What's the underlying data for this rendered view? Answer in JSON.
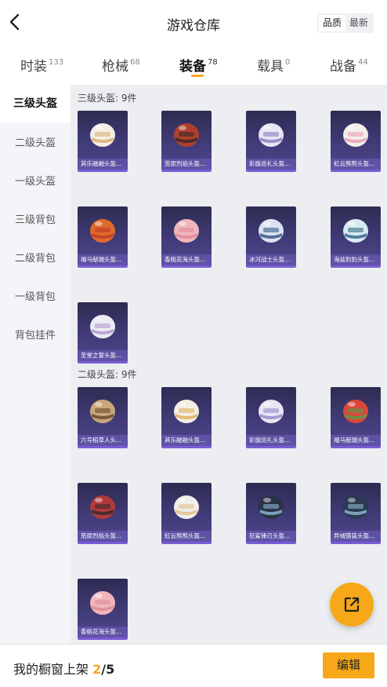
{
  "header": {
    "title": "游戏仓库",
    "sort_options": [
      "品质",
      "最新"
    ],
    "sort_selected": "品质"
  },
  "tabs": [
    {
      "label": "时装",
      "count": "133"
    },
    {
      "label": "枪械",
      "count": "68"
    },
    {
      "label": "装备",
      "count": "78",
      "active": true
    },
    {
      "label": "载具",
      "count": "0"
    },
    {
      "label": "战备",
      "count": "44"
    }
  ],
  "sidebar": {
    "items": [
      {
        "label": "三级头盔",
        "active": true
      },
      {
        "label": "二级头盔"
      },
      {
        "label": "一级头盔"
      },
      {
        "label": "三级背包"
      },
      {
        "label": "二级背包"
      },
      {
        "label": "一级背包"
      },
      {
        "label": "背包挂件"
      }
    ]
  },
  "sections": [
    {
      "title": "三级头盔: 9件",
      "items": [
        {
          "name": "其乐融融头盔...",
          "color": "#f3eee6",
          "accent": "#d8b070"
        },
        {
          "name": "荒原烈焰头盔...",
          "color": "#b0402c",
          "accent": "#3a2a2a"
        },
        {
          "name": "彩旗巡礼头盔...",
          "color": "#e8e6f2",
          "accent": "#8b7fc8"
        },
        {
          "name": "虹云熊熊头盔...",
          "color": "#f2efe9",
          "accent": "#e7a0b4"
        },
        {
          "name": "福马献瑞头盔...",
          "color": "#e06a2a",
          "accent": "#c23a2a"
        },
        {
          "name": "香桃花海头盔...",
          "color": "#f1b6bd",
          "accent": "#e08a96"
        },
        {
          "name": "冰河战士头盔...",
          "color": "#d9e3f0",
          "accent": "#3a5a8a"
        },
        {
          "name": "海盐豹豹头盔...",
          "color": "#d7ecf2",
          "accent": "#3a6a8a"
        },
        {
          "name": "圣堂之誓头盔...",
          "color": "#ecebf1",
          "accent": "#b09ad6"
        }
      ]
    },
    {
      "title": "二级头盔: 9件",
      "items": [
        {
          "name": "六号稻草人头...",
          "color": "#c9a77a",
          "accent": "#6a4a2a"
        },
        {
          "name": "其乐融融头盔...",
          "color": "#f3eee2",
          "accent": "#e0b060"
        },
        {
          "name": "彩旗巡礼头盔...",
          "color": "#e8e6f2",
          "accent": "#9a8ad0"
        },
        {
          "name": "福马献瑞头盔...",
          "color": "#d9483a",
          "accent": "#5a9a4a"
        },
        {
          "name": "荒原烈焰头盔...",
          "color": "#b03a3a",
          "accent": "#3a2a2a"
        },
        {
          "name": "虹云熊熊头盔...",
          "color": "#efeeea",
          "accent": "#e3c08a"
        },
        {
          "name": "狂鲨锋刃头盔...",
          "color": "#2a3344",
          "accent": "#8ab4cf"
        },
        {
          "name": "异域猎装头盔...",
          "color": "#2a3a50",
          "accent": "#8ab4cf"
        },
        {
          "name": "香桃花海头盔...",
          "color": "#f1b6bd",
          "accent": "#e08a96"
        }
      ]
    }
  ],
  "bottom": {
    "label": "我的橱窗上架",
    "current": "2",
    "separator": "/",
    "max": "5",
    "edit_label": "编辑"
  },
  "icons": {
    "back": "chevron-left-icon",
    "share": "external-link-icon"
  },
  "colors": {
    "accent": "#f7a818",
    "item_card": "#3d3770"
  }
}
